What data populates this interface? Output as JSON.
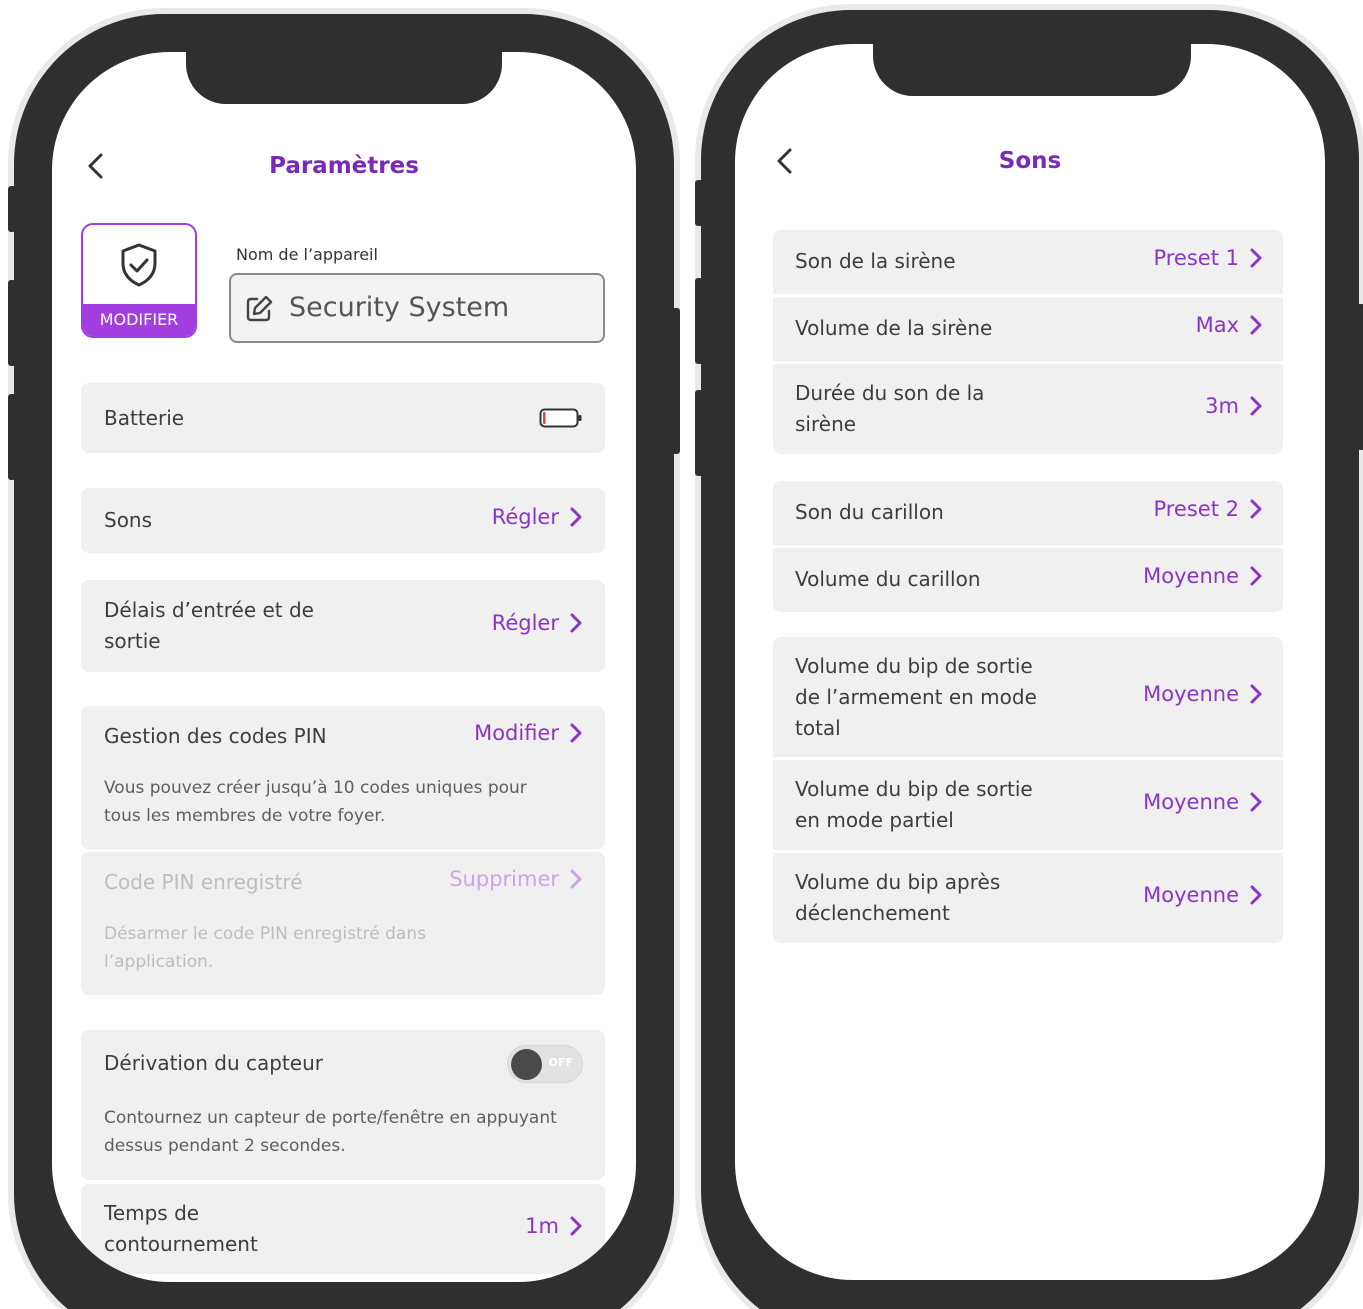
{
  "left": {
    "title": "Paramètres",
    "device_badge": "MODIFIER",
    "device_name_label": "Nom de l’appareil",
    "device_name_value": "Security System",
    "battery_label": "Batterie",
    "sounds": {
      "label": "Sons",
      "action": "Régler"
    },
    "delays": {
      "label": "Délais d’entrée et de sortie",
      "action": "Régler"
    },
    "pin": {
      "label": "Gestion des codes PIN",
      "action": "Modifier",
      "description": "Vous pouvez créer jusqu’à 10 codes uniques pour tous les membres de votre foyer."
    },
    "saved_pin": {
      "label": "Code PIN enregistré",
      "action": "Supprimer",
      "description": "Désarmer le code PIN enregistré dans l’application."
    },
    "bypass": {
      "label": "Dérivation du capteur",
      "toggle_text": "OFF",
      "description": "Contournez un capteur de porte/fenêtre en appuyant dessus pendant 2 secondes."
    },
    "bypass_time": {
      "label": "Temps de contournement",
      "action": "1m"
    }
  },
  "right": {
    "title": "Sons",
    "group1": [
      {
        "label": "Son de la sirène",
        "value": "Preset 1"
      },
      {
        "label": "Volume de la sirène",
        "value": "Max"
      },
      {
        "label": "Durée du son de la sirène",
        "value": "3m"
      }
    ],
    "group2": [
      {
        "label": "Son du carillon",
        "value": "Preset 2"
      },
      {
        "label": "Volume du carillon",
        "value": "Moyenne"
      }
    ],
    "group3": [
      {
        "label": "Volume du bip de sortie de l’armement en mode total",
        "value": "Moyenne"
      },
      {
        "label": "Volume du bip de sortie en mode partiel",
        "value": "Moyenne"
      },
      {
        "label": "Volume du bip après déclenchement",
        "value": "Moyenne"
      }
    ]
  },
  "colors": {
    "accent": "#7a2bb5",
    "badge": "#a23ee0",
    "row_bg": "#f0f0f0",
    "frame": "#2f2f2f"
  },
  "icons": [
    "chevron-left-icon",
    "shield-check-icon",
    "edit-icon",
    "battery-icon",
    "chevron-right-icon",
    "toggle-switch"
  ]
}
